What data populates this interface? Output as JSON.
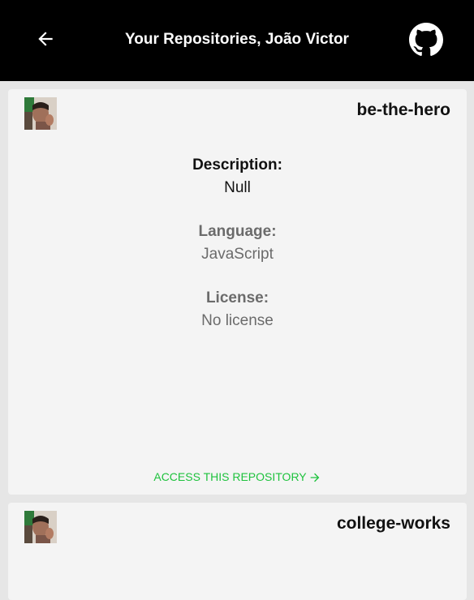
{
  "header": {
    "title": "Your Repositories, João Victor",
    "back_icon": "arrow-left-icon",
    "github_icon": "github-icon"
  },
  "colors": {
    "header_bg": "#000000",
    "page_bg": "#e6e6e6",
    "card_bg": "#f4f4f4",
    "accent": "#1ec23d"
  },
  "repos": [
    {
      "name": "be-the-hero",
      "description_label": "Description:",
      "description": "Null",
      "language_label": "Language:",
      "language": "JavaScript",
      "license_label": "License:",
      "license": "No license",
      "access_label": "ACCESS THIS REPOSITORY"
    },
    {
      "name": "college-works"
    }
  ]
}
